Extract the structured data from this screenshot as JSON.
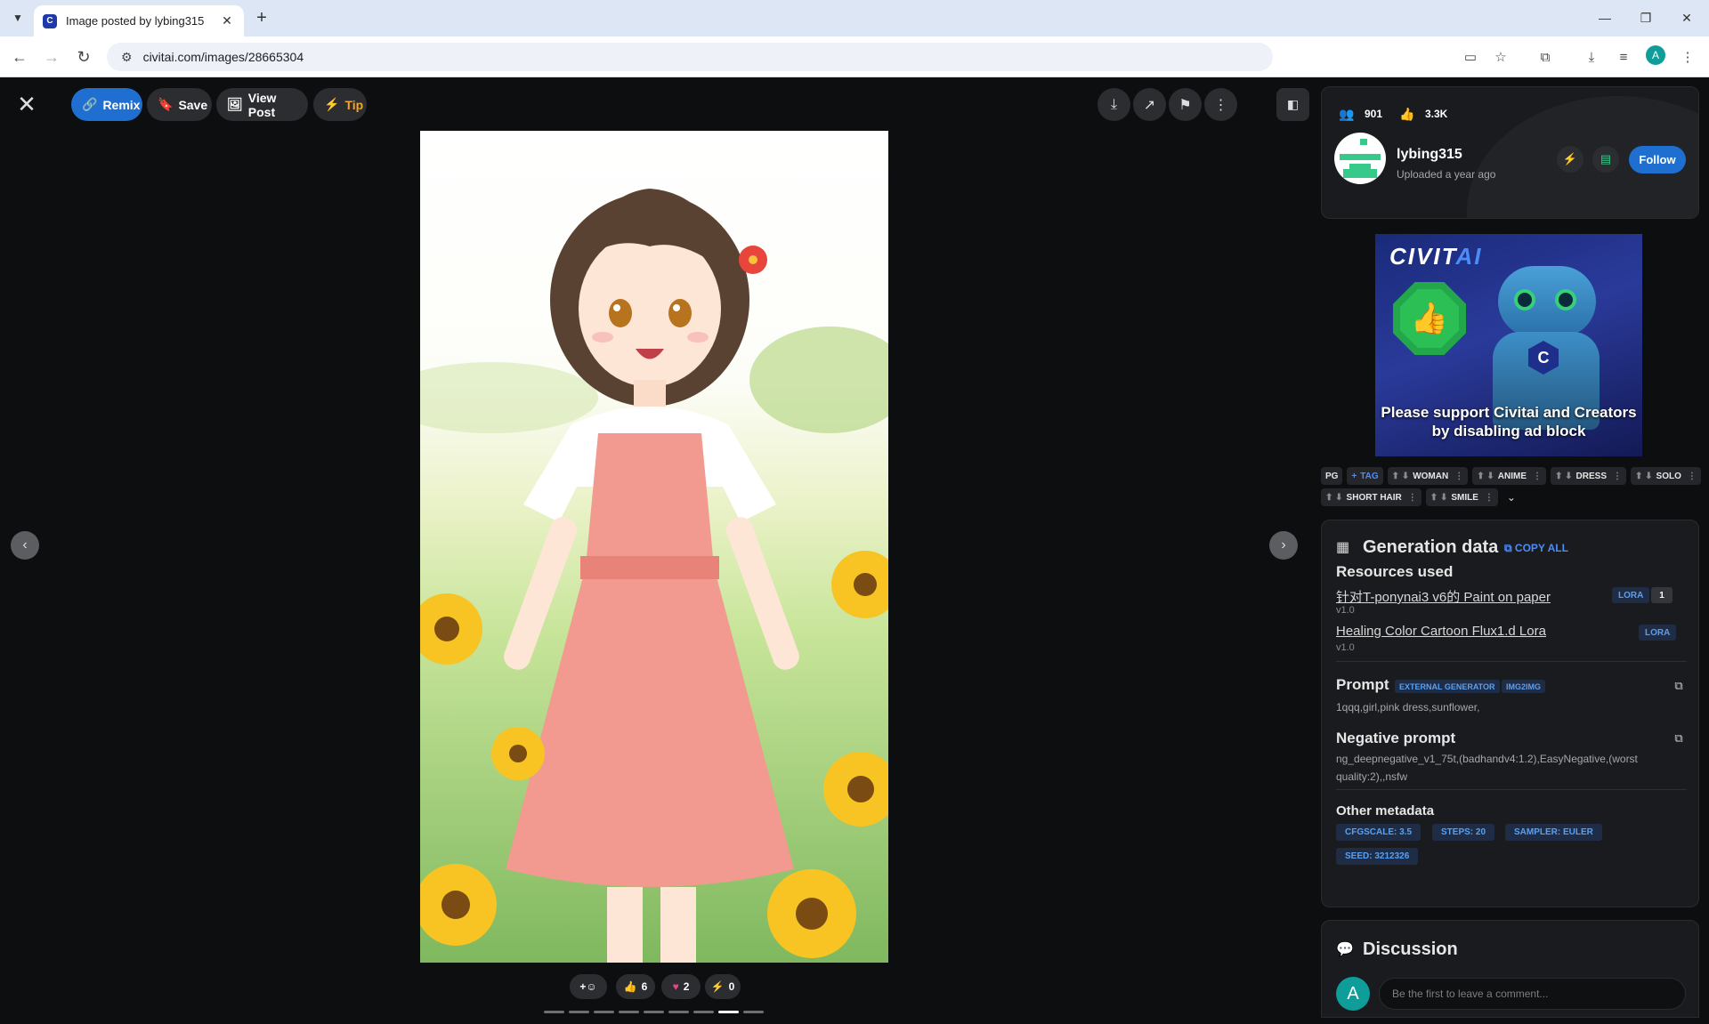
{
  "browser": {
    "tab_title": "Image posted by lybing315",
    "url": "civitai.com/images/28665304",
    "profile_initial": "A"
  },
  "viewer": {
    "actions": {
      "remix": "Remix",
      "save": "Save",
      "view_post": "View Post",
      "tip": "Tip"
    },
    "reactions": {
      "like_count": "6",
      "heart_count": "2",
      "buzz_count": "0"
    },
    "carousel_total": 9,
    "carousel_active_index": 7
  },
  "user": {
    "followers": "901",
    "likes": "3.3K",
    "username": "lybing315",
    "uploaded": "Uploaded a year ago",
    "follow_label": "Follow"
  },
  "ad": {
    "brand_prefix": "CIVIT",
    "brand_suffix": "AI",
    "message": "Please support Civitai and Creators by disabling ad block"
  },
  "tags": {
    "rating": "PG",
    "add_label": "TAG",
    "items": [
      "WOMAN",
      "ANIME",
      "DRESS",
      "SOLO",
      "SHORT HAIR",
      "SMILE"
    ]
  },
  "generation": {
    "title": "Generation data",
    "copy_all": "COPY ALL",
    "resources_heading": "Resources used",
    "resources": [
      {
        "name": "针对T-ponynai3 v6的 Paint on paper",
        "version": "v1.0",
        "type": "LORA",
        "count": "1"
      },
      {
        "name": "Healing Color Cartoon Flux1.d Lora",
        "version": "v1.0",
        "type": "LORA"
      }
    ],
    "prompt_heading": "Prompt",
    "prompt_badges": [
      "EXTERNAL GENERATOR",
      "IMG2IMG"
    ],
    "prompt": "1qqq,girl,pink dress,sunflower,",
    "negative_heading": "Negative prompt",
    "negative_prompt": "ng_deepnegative_v1_75t,(badhandv4:1.2),EasyNegative,(worst quality:2),,nsfw",
    "metadata_heading": "Other metadata",
    "metadata": [
      "CFGSCALE: 3.5",
      "STEPS: 20",
      "SAMPLER: EULER",
      "SEED: 3212326"
    ]
  },
  "discussion": {
    "title": "Discussion",
    "avatar_initial": "A",
    "placeholder": "Be the first to leave a comment..."
  }
}
